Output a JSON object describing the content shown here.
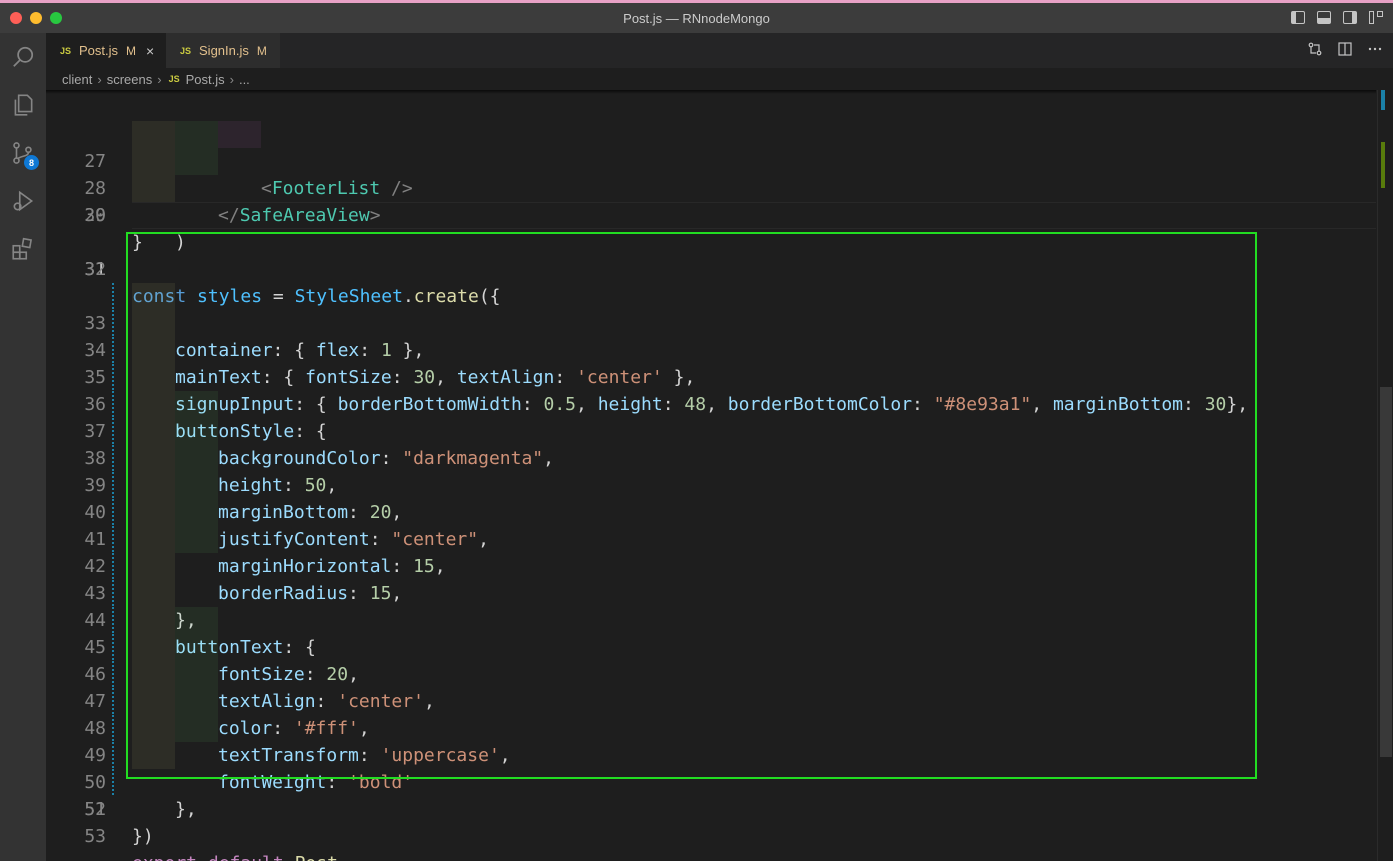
{
  "window": {
    "title": "Post.js — RNnodeMongo"
  },
  "activity_bar": {
    "items": [
      {
        "name": "explorer-search",
        "icon": "search-icon"
      },
      {
        "name": "explorer",
        "icon": "files-icon"
      },
      {
        "name": "source-control",
        "icon": "source-control-icon",
        "badge": "8"
      },
      {
        "name": "run-debug",
        "icon": "run-debug-icon"
      },
      {
        "name": "extensions",
        "icon": "extensions-icon"
      }
    ]
  },
  "tabs": [
    {
      "icon": "JS",
      "label": "Post.js",
      "modified": "M",
      "close": "×",
      "active": true
    },
    {
      "icon": "JS",
      "label": "SignIn.js",
      "modified": "M",
      "active": false
    }
  ],
  "breadcrumb": {
    "parts": [
      "client",
      "screens",
      "Post.js",
      "..."
    ],
    "file_icon": "JS"
  },
  "editor": {
    "current_line": "31",
    "lines": [
      {
        "n": "27"
      },
      {
        "n": "28"
      },
      {
        "n": "29"
      },
      {
        "n": "30"
      },
      {
        "n": "31"
      },
      {
        "n": "32"
      },
      {
        "n": "33"
      },
      {
        "n": "34"
      },
      {
        "n": "35"
      },
      {
        "n": "36"
      },
      {
        "n": "37"
      },
      {
        "n": "38"
      },
      {
        "n": "39"
      },
      {
        "n": "40"
      },
      {
        "n": "41"
      },
      {
        "n": "42"
      },
      {
        "n": "43"
      },
      {
        "n": "44"
      },
      {
        "n": "45"
      },
      {
        "n": "46"
      },
      {
        "n": "47"
      },
      {
        "n": "48"
      },
      {
        "n": "49"
      },
      {
        "n": "50"
      },
      {
        "n": "51"
      },
      {
        "n": "52"
      },
      {
        "n": "53"
      }
    ],
    "tokens": {
      "l27": [
        "<",
        "FooterList",
        " />"
      ],
      "l28": [
        "</",
        "SafeAreaView",
        ">"
      ],
      "l29": [
        ")"
      ],
      "l30": [
        "}"
      ],
      "l32": [
        "const",
        " ",
        "styles",
        " = ",
        "StyleSheet",
        ".",
        "create",
        "({"
      ],
      "l33": [
        "container",
        ": { ",
        "flex",
        ": ",
        "1",
        " },"
      ],
      "l34": [
        "mainText",
        ": { ",
        "fontSize",
        ": ",
        "30",
        ", ",
        "textAlign",
        ": ",
        "'center'",
        " },"
      ],
      "l35": [
        "signupInput",
        ": { ",
        "borderBottomWidth",
        ": ",
        "0.5",
        ", ",
        "height",
        ": ",
        "48",
        ", ",
        "borderBottomColor",
        ": ",
        "\"#8e93a1\"",
        ", ",
        "marginBottom",
        ": ",
        "30",
        "},"
      ],
      "l36": [
        "buttonStyle",
        ": {"
      ],
      "l37": [
        "backgroundColor",
        ": ",
        "\"darkmagenta\"",
        ","
      ],
      "l38": [
        "height",
        ": ",
        "50",
        ","
      ],
      "l39": [
        "marginBottom",
        ": ",
        "20",
        ","
      ],
      "l40": [
        "justifyContent",
        ": ",
        "\"center\"",
        ","
      ],
      "l41": [
        "marginHorizontal",
        ": ",
        "15",
        ","
      ],
      "l42": [
        "borderRadius",
        ": ",
        "15",
        ","
      ],
      "l43": [
        "},"
      ],
      "l44": [
        "buttonText",
        ": {"
      ],
      "l45": [
        "fontSize",
        ": ",
        "20",
        ","
      ],
      "l46": [
        "textAlign",
        ": ",
        "'center'",
        ","
      ],
      "l47": [
        "color",
        ": ",
        "'#fff'",
        ","
      ],
      "l48": [
        "textTransform",
        ": ",
        "'uppercase'",
        ","
      ],
      "l49": [
        "fontWeight",
        ": ",
        "'bold'"
      ],
      "l50": [
        "},"
      ],
      "l51": [
        "})"
      ],
      "l53": [
        "export",
        " ",
        "default",
        " ",
        "Post"
      ]
    }
  },
  "colors": {
    "highlight_box": "#22dd22",
    "badge": "#0e78d5",
    "modified": "#e2c08d"
  }
}
